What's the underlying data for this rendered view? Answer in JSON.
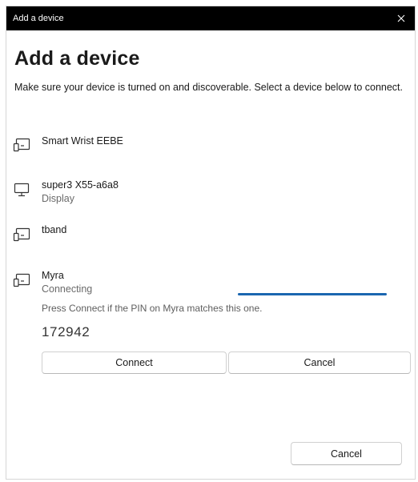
{
  "window": {
    "title": "Add a device",
    "close_glyph": "✕"
  },
  "heading": "Add a device",
  "description": "Make sure your device is turned on and discoverable. Select a device below to connect.",
  "devices": [
    {
      "name": "Smart Wrist EEBE",
      "status": "",
      "icon": "input-device-icon"
    },
    {
      "name": "super3 X55-a6a8",
      "status": "Display",
      "icon": "monitor-icon"
    },
    {
      "name": "tband",
      "status": "",
      "icon": "input-device-icon"
    },
    {
      "name": "Myra",
      "status": "Connecting",
      "icon": "input-device-icon"
    }
  ],
  "pairing": {
    "prompt": "Press Connect if the PIN on Myra matches this one.",
    "pin": "172942",
    "connect_label": "Connect",
    "cancel_label": "Cancel"
  },
  "footer": {
    "cancel_label": "Cancel"
  },
  "colors": {
    "titlebar": "#000000",
    "progress_accent": "#1a66b0"
  }
}
